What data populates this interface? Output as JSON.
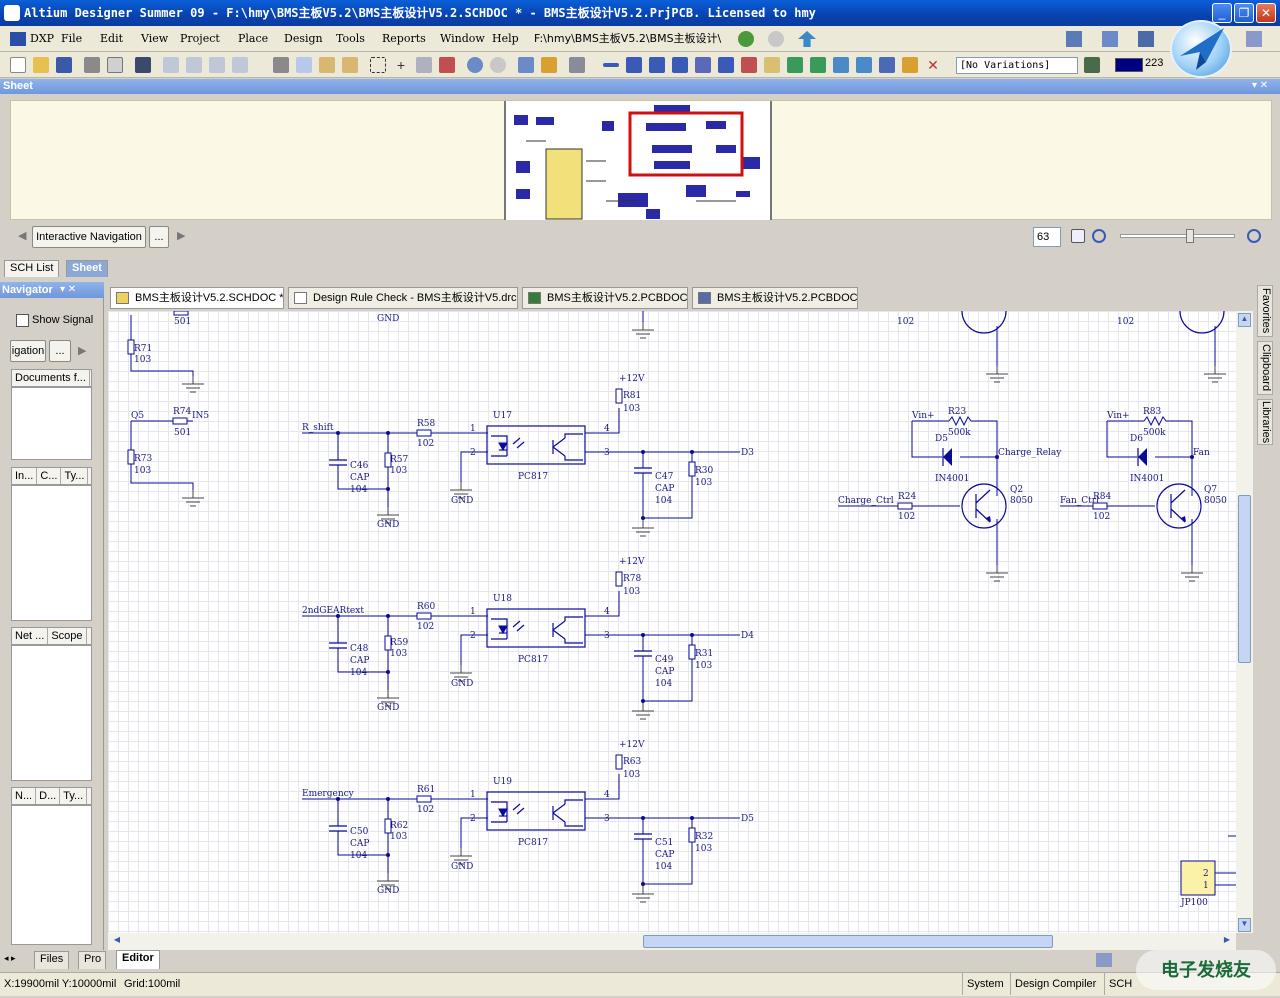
{
  "window": {
    "title": "Altium Designer Summer 09 - F:\\hmy\\BMS主板V5.2\\BMS主板设计V5.2.SCHDOC * - BMS主板设计V5.2.PrjPCB. Licensed to hmy",
    "minimize": "_",
    "maximize": "❐",
    "close": "✕"
  },
  "menu": {
    "items": [
      "DXP",
      "File",
      "Edit",
      "View",
      "Project",
      "Place",
      "Design",
      "Tools",
      "Reports",
      "Window",
      "Help"
    ],
    "path": "F:\\hmy\\BMS主板V5.2\\BMS主板设计\\"
  },
  "toolbar": {
    "variations": "[No Variations]",
    "color_value": "223",
    "color": "#000080"
  },
  "sheet_panel": {
    "title": "Sheet",
    "nav_button": "Interactive Navigation",
    "more_button": "...",
    "zoom": "63"
  },
  "panel_tabs": [
    "SCH List",
    "Sheet"
  ],
  "navigator": {
    "title": "Navigator",
    "show_signal": "Show Signal",
    "nav_button": "igation",
    "more_button": "...",
    "documents_header": "Documents f...",
    "columns1": [
      "In...",
      "C...",
      "Ty..."
    ],
    "columns2": [
      "Net ...",
      "Scope"
    ],
    "columns3": [
      "N...",
      "D...",
      "Ty..."
    ]
  },
  "doc_tabs": [
    "BMS主板设计V5.2.SCHDOC *",
    "Design Rule Check - BMS主板设计V5.drc",
    "BMS主板设计V5.2.PCBDOC",
    "BMS主板设计V5.2.PCBDOC"
  ],
  "right_dock": [
    "Favorites",
    "Clipboard",
    "Libraries"
  ],
  "bottom_tabs": [
    "Files",
    "Pro",
    "Editor"
  ],
  "status": {
    "coords": "X:19900mil Y:10000mil",
    "grid": "Grid:100mil",
    "system": "System",
    "design_compiler": "Design Compiler",
    "sch": "SCH",
    "watermark": "电子发烧友"
  },
  "schematic": {
    "top": {
      "r_label": "501",
      "gnd": "GND",
      "r1": "102",
      "r2": "102"
    },
    "left": {
      "r71": "R71",
      "r71v": "103",
      "q5": "Q5",
      "r74": "R74",
      "r74v": "501",
      "ins": "IN5",
      "r73": "R73",
      "r73v": "103"
    },
    "blocks": [
      {
        "net": "R_shift",
        "r_in": "R58",
        "r_in_v": "102",
        "u": "U17",
        "cap": "C46",
        "cap_t": "CAP",
        "cap_v": "104",
        "r_dn": "R57",
        "r_dn_v": "103",
        "gnd": "GND",
        "gnd2": "GND",
        "vcc": "+12V",
        "r_pu": "R81",
        "r_pu_v": "103",
        "part": "PC817",
        "cap2": "C47",
        "cap2_t": "CAP",
        "cap2_v": "104",
        "r_out": "R30",
        "r_out_v": "103",
        "out": "D3",
        "p1": "1",
        "p2": "2",
        "p3": "3",
        "p4": "4"
      },
      {
        "net": "2ndGEARtext",
        "r_in": "R60",
        "r_in_v": "102",
        "u": "U18",
        "cap": "C48",
        "cap_t": "CAP",
        "cap_v": "104",
        "r_dn": "R59",
        "r_dn_v": "103",
        "gnd": "GND",
        "gnd2": "GND",
        "vcc": "+12V",
        "r_pu": "R78",
        "r_pu_v": "103",
        "part": "PC817",
        "cap2": "C49",
        "cap2_t": "CAP",
        "cap2_v": "104",
        "r_out": "R31",
        "r_out_v": "103",
        "out": "D4",
        "p1": "1",
        "p2": "2",
        "p3": "3",
        "p4": "4"
      },
      {
        "net": "Emergency",
        "r_in": "R61",
        "r_in_v": "102",
        "u": "U19",
        "cap": "C50",
        "cap_t": "CAP",
        "cap_v": "104",
        "r_dn": "R62",
        "r_dn_v": "103",
        "gnd": "GND",
        "gnd2": "GND",
        "vcc": "+12V",
        "r_pu": "R63",
        "r_pu_v": "103",
        "part": "PC817",
        "cap2": "C51",
        "cap2_t": "CAP",
        "cap2_v": "104",
        "r_out": "R32",
        "r_out_v": "103",
        "out": "D5",
        "p1": "1",
        "p2": "2",
        "p3": "3",
        "p4": "4"
      }
    ],
    "relay": {
      "vin": "Vin+",
      "r": "R23",
      "rv": "500k",
      "d": "D5",
      "dn": "IN4001",
      "net": "Charge_Relay",
      "ctrl": "Charge_Ctrl",
      "rb": "R24",
      "rbv": "102",
      "q": "Q2",
      "qn": "8050"
    },
    "fan": {
      "vin": "Vin+",
      "r": "R83",
      "rv": "500k",
      "d": "D6",
      "dn": "IN4001",
      "net": "Fan",
      "ctrl": "Fan_Ctrl",
      "rb": "R84",
      "rbv": "102",
      "q": "Q7",
      "qn": "8050"
    },
    "jp": {
      "p2": "2",
      "p1": "1",
      "name": "JP100"
    }
  }
}
